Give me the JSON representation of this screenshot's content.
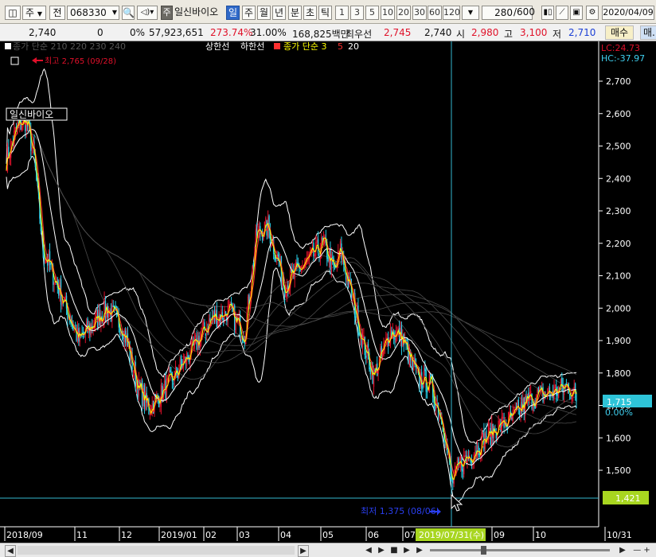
{
  "toolbar": {
    "period": "주",
    "scope": "전",
    "code": "068330",
    "stock_name": "일신바이오",
    "mode_badge": "주",
    "tab_day": "일",
    "tab_week": "주",
    "tab_month": "월",
    "tab_year": "년",
    "tab_min": "분",
    "tab_tick_cho": "초",
    "tab_tick": "틱",
    "intervals": [
      "1",
      "3",
      "5",
      "10",
      "20",
      "30",
      "60",
      "120"
    ],
    "count_value": "280",
    "count_total": "/600",
    "date": "2020/04/09"
  },
  "quote": {
    "price": "2,740",
    "change": "0",
    "change_pct": "0%",
    "volume": "57,923,651",
    "vol_ratio": "273.74%",
    "turnover": "31.00%",
    "amount": "168,825백만",
    "best_ask_label": "최우선",
    "best_ask": "2,745",
    "best_bid": "2,740",
    "open_label": "시",
    "open": "2,980",
    "high_label": "고",
    "high": "3,100",
    "low_label": "저",
    "low": "2,710",
    "buy_btn": "매수",
    "sell_btn": "매."
  },
  "legend": {
    "stock_box": "일신바이오",
    "line1": "종가 단순 210  220  230  240",
    "upper": "상한선",
    "lower": "하한선",
    "ma_label": "종가 단순 3",
    "ma5": "5",
    "ma20": "20",
    "high_note": "최고 2,765 (09/28)",
    "low_note": "최저 1,375 (08/06)",
    "lc": "LC:24.73",
    "hc": "HC:-37.97",
    "price_tag": "1,715",
    "pct_tag": "0.00%",
    "cross_tag": "1,421",
    "date_tag": "2019/07/31(수)"
  },
  "colors": {
    "up": "#e0102a",
    "down": "#28d0e8",
    "ma3": "#ffff00",
    "ma5": "#ff3030",
    "ma20": "#ffffff",
    "crosshair": "#35b7cf"
  },
  "chart_data": {
    "type": "candlestick",
    "y_ticks": [
      "2,700",
      "2,600",
      "2,500",
      "2,400",
      "2,300",
      "2,200",
      "2,100",
      "2,000",
      "1,900",
      "1,800",
      "1,700",
      "1,600",
      "1,500"
    ],
    "x_labels": [
      "2018/09",
      "11",
      "12",
      "2019/01",
      "02",
      "03",
      "04",
      "05",
      "06",
      "07",
      "09",
      "10",
      "10/31"
    ],
    "ylim": [
      1380,
      2780
    ],
    "anchors": [
      [
        0,
        2460
      ],
      [
        10,
        2560
      ],
      [
        18,
        2580
      ],
      [
        25,
        2460
      ],
      [
        33,
        2180
      ],
      [
        47,
        2060
      ],
      [
        65,
        1900
      ],
      [
        75,
        1940
      ],
      [
        90,
        2000
      ],
      [
        105,
        1940
      ],
      [
        118,
        1760
      ],
      [
        128,
        1690
      ],
      [
        145,
        1760
      ],
      [
        165,
        1860
      ],
      [
        185,
        1970
      ],
      [
        200,
        1990
      ],
      [
        214,
        1920
      ],
      [
        225,
        2230
      ],
      [
        235,
        2250
      ],
      [
        250,
        2070
      ],
      [
        260,
        2110
      ],
      [
        275,
        2160
      ],
      [
        285,
        2200
      ],
      [
        295,
        2110
      ],
      [
        300,
        2180
      ],
      [
        310,
        2040
      ],
      [
        320,
        1900
      ],
      [
        330,
        1790
      ],
      [
        345,
        1930
      ],
      [
        355,
        1910
      ],
      [
        370,
        1780
      ],
      [
        380,
        1770
      ],
      [
        392,
        1650
      ],
      [
        400,
        1460
      ],
      [
        408,
        1520
      ],
      [
        420,
        1560
      ],
      [
        440,
        1630
      ],
      [
        455,
        1660
      ],
      [
        470,
        1720
      ],
      [
        490,
        1740
      ],
      [
        505,
        1760
      ],
      [
        512,
        1720
      ]
    ]
  },
  "scroll": {
    "btns": [
      "◀",
      "▶",
      "■",
      "▶",
      "▶"
    ],
    "zoom": "— +",
    "left_arrow": "◀"
  }
}
